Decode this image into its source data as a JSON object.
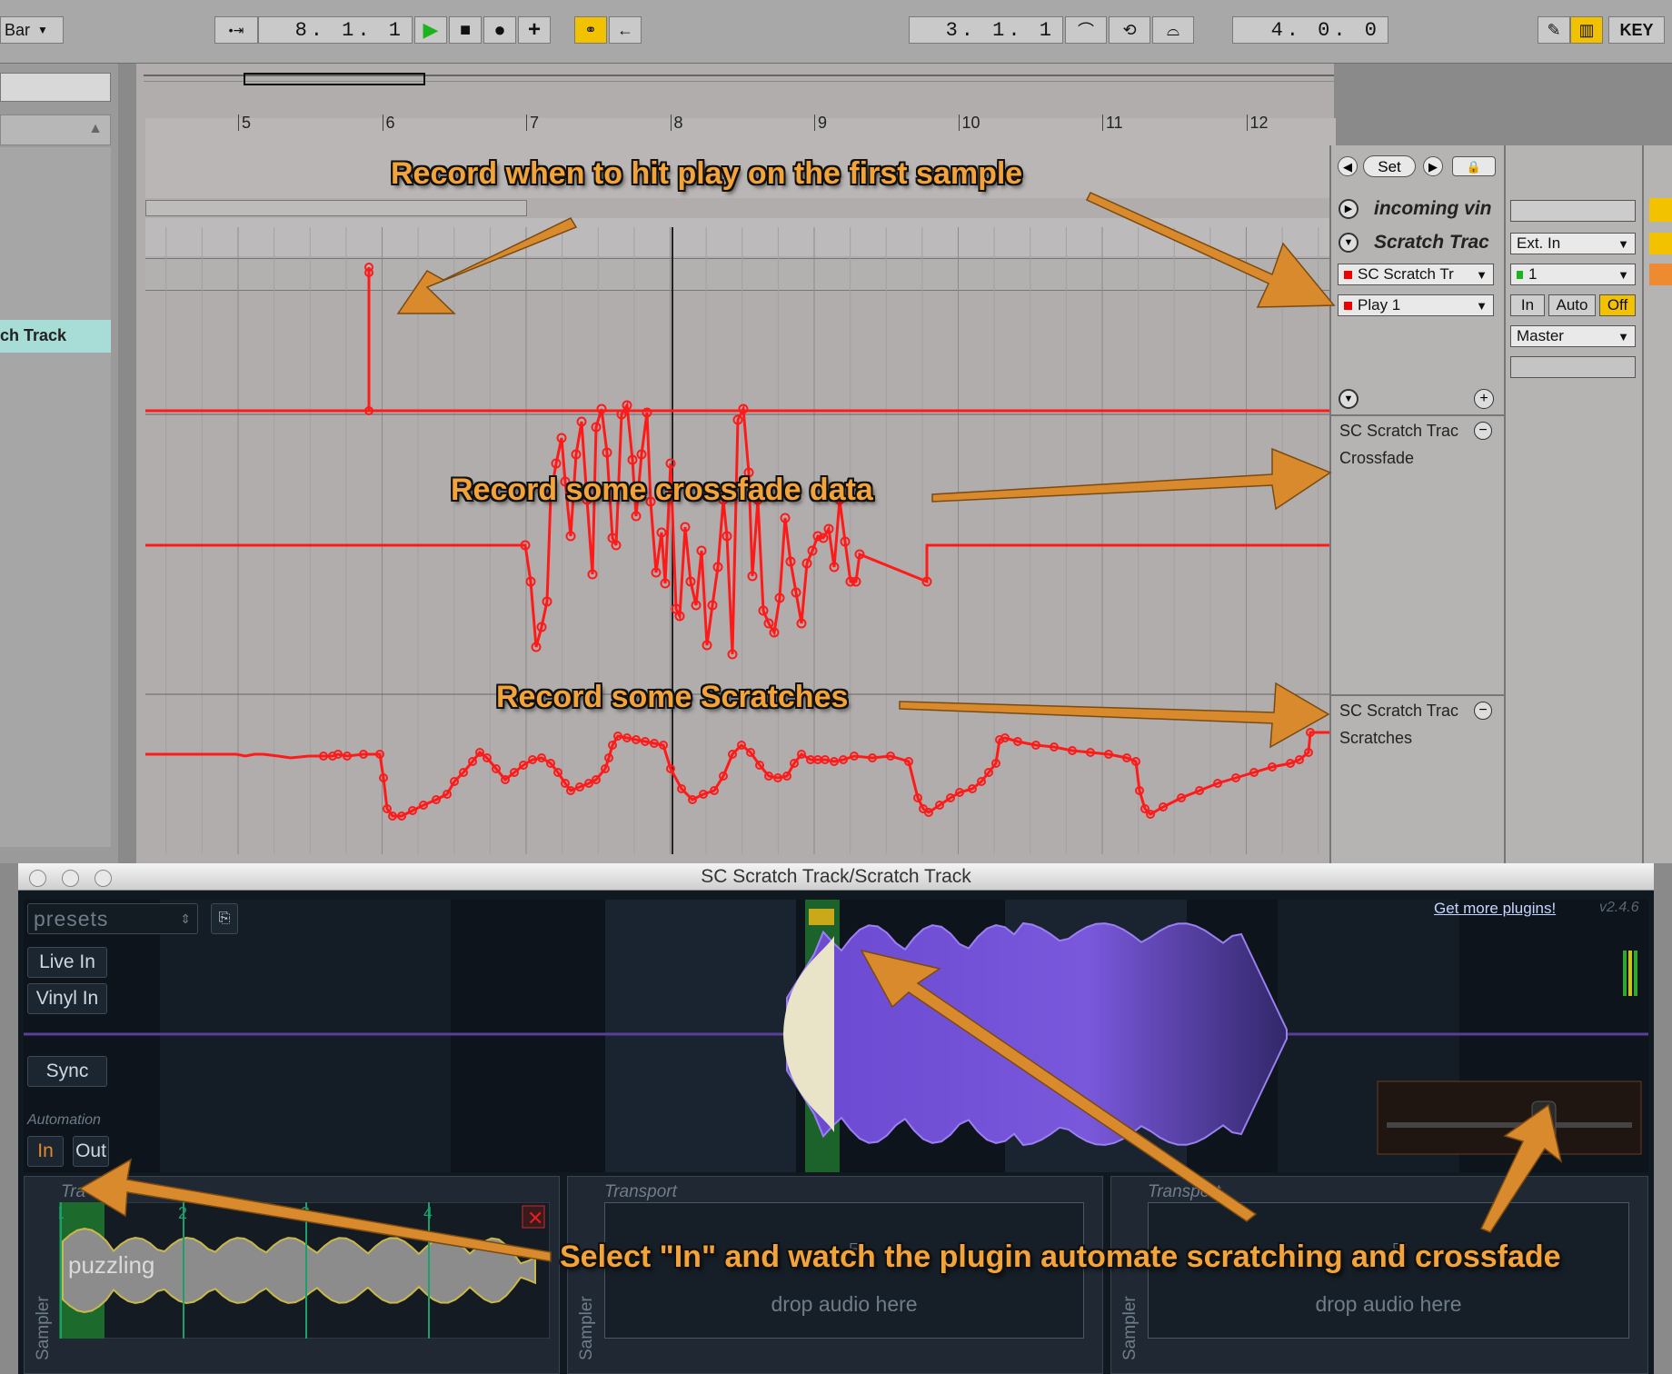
{
  "transport": {
    "quantize": "Bar",
    "position": "8.  1.  1",
    "loop_start": "3.  1.  1",
    "loop_length": "4.  0.  0",
    "key": "KEY"
  },
  "browser": {
    "selected_track": "ch Track"
  },
  "ruler": {
    "bars": [
      "5",
      "6",
      "7",
      "8",
      "9",
      "10",
      "11",
      "12"
    ]
  },
  "locators": {
    "set_label": "Set"
  },
  "tracks": {
    "incoming": "incoming vin",
    "scratch": "Scratch Trac",
    "device_chooser": "SC Scratch Tr",
    "param_chooser": "Play 1",
    "input_type": "Ext. In",
    "input_channel": "1",
    "monitor": [
      "In",
      "Auto",
      "Off"
    ],
    "output": "Master",
    "lane_crossfade_device": "SC Scratch Trac",
    "lane_crossfade_param": "Crossfade",
    "lane_scratches_device": "SC Scratch Trac",
    "lane_scratches_param": "Scratches"
  },
  "annotations": {
    "play": "Record when to hit play on the first sample",
    "crossfade": "Record some crossfade data",
    "scratches": "Record some Scratches",
    "select_in": "Select \"In\" and watch the plugin automate scratching and crossfade"
  },
  "plugin": {
    "window_title": "SC Scratch Track/Scratch Track",
    "presets": "presets",
    "live_in": "Live In",
    "vinyl_in": "Vinyl In",
    "sync": "Sync",
    "automation_label": "Automation",
    "auto_in": "In",
    "auto_out": "Out",
    "get_more": "Get more plugins!",
    "version": "v2.4.6",
    "panels": [
      {
        "title": "Tra",
        "vertical": "Sampler",
        "sample_name": "puzzling",
        "markers": [
          "1",
          "2",
          "3",
          "4"
        ]
      },
      {
        "title": "Transport",
        "vertical": "Sampler",
        "drop": "drop audio here"
      },
      {
        "title": "Transport",
        "vertical": "Sampler",
        "drop": "drop audio here"
      }
    ]
  },
  "colors": {
    "automation": "#ff1a1a",
    "annotation_text": "#f2a43a",
    "arrow": "#d88a2c",
    "waveform": "#7a55d8",
    "accent_yellow": "#f2c200"
  }
}
